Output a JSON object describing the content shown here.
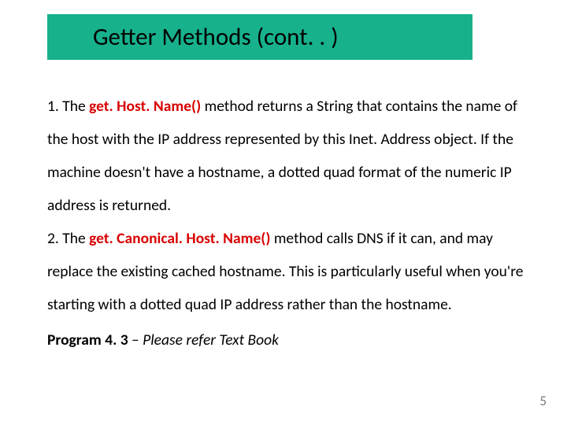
{
  "title": "Getter Methods (cont. . )",
  "p1_prefix": "1. The ",
  "p1_method": "get. Host. Name()",
  "p1_rest": " method returns a String that contains the name of the host with the IP address represented by this Inet. Address object. If the machine doesn't have a hostname, a dotted quad format of the numeric IP address is returned.",
  "p2_prefix": "2. The ",
  "p2_method": "get. Canonical. Host. Name()",
  "p2_rest": " method calls DNS if it can, and may replace the existing cached hostname. This is particularly useful when you're starting with a dotted quad IP address rather than the hostname.",
  "program_label": "Program 4. 3",
  "program_sep": " – ",
  "program_ref": "Please refer Text Book",
  "pagenum": "5"
}
